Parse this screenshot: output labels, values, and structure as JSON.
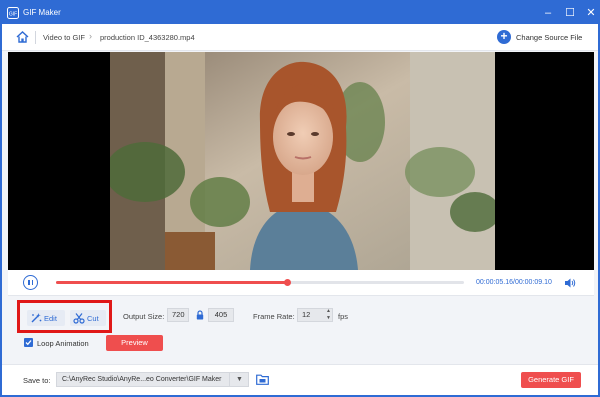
{
  "window": {
    "title": "GIF Maker",
    "minimize_icon": "minimize-icon",
    "maximize_icon": "maximize-icon",
    "close_icon": "close-icon"
  },
  "breadcrumb": {
    "home_icon": "home-icon",
    "items": [
      "Video to GIF",
      "production ID_4363280.mp4"
    ],
    "separator_icon": "chevron-right-icon"
  },
  "change_source": {
    "label": "Change Source File",
    "icon": "plus-circle-icon"
  },
  "playback": {
    "current_time": "00:00:05.16",
    "total_time": "00:00:09.10",
    "progress": 0.567
  },
  "edit": {
    "edit_label": "Edit",
    "cut_label": "Cut"
  },
  "output": {
    "size_label": "Output Size:",
    "width": "720",
    "height": "405",
    "frame_rate_label": "Frame Rate:",
    "frame_rate": "12",
    "fps_label": "fps"
  },
  "options": {
    "loop_label": "Loop Animation",
    "loop_checked": true,
    "preview_label": "Preview"
  },
  "save": {
    "label": "Save to:",
    "path": "C:\\AnyRec Studio\\AnyRe...eo Converter\\GIF Maker",
    "generate_label": "Generate GIF"
  },
  "colors": {
    "accent": "#2f6bd4",
    "action": "#ef4e4e",
    "highlight": "#e01818"
  }
}
